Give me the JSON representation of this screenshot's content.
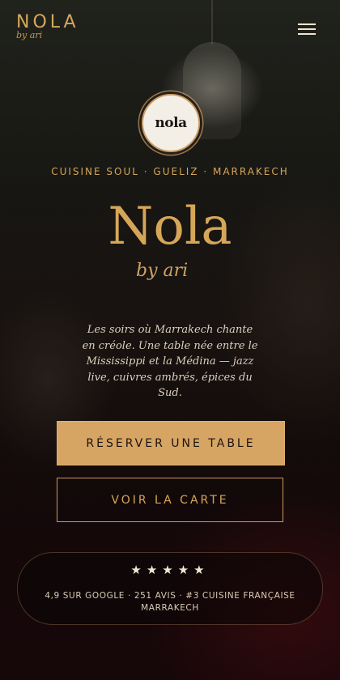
{
  "header": {
    "logo_main": "NOLA",
    "logo_sub": "by ari",
    "menu_icon": "hamburger-menu-icon"
  },
  "badge": {
    "text": "nola"
  },
  "hero": {
    "tagline": "CUISINE SOUL · GUELIZ · MARRAKECH",
    "title": "Nola",
    "subtitle": "by ari",
    "intro": "Les soirs où Marrakech chante en créole. Une table née entre le Mississippi et la Médina — jazz live, cuivres ambrés, épices du Sud."
  },
  "actions": {
    "reserve_label": "RÉSERVER UNE TABLE",
    "menu_label": "VOIR LA CARTE"
  },
  "rating": {
    "stars": "★★★★★",
    "star_count": 5,
    "line1": "4,9 SUR GOOGLE · 251 AVIS · #3 CUISINE FRANÇAISE",
    "line2": "MARRAKECH"
  },
  "colors": {
    "accent_gold": "#d6a658",
    "button_fill": "#d6a463",
    "background": "#140c0b"
  }
}
